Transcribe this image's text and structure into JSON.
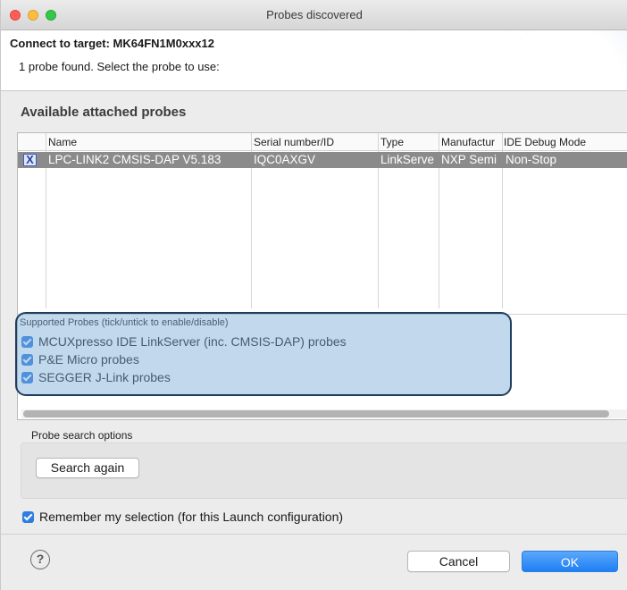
{
  "window": {
    "title": "Probes discovered"
  },
  "header": {
    "title": "Connect to target: MK64FN1M0xxx12",
    "message": "1 probe found. Select the probe to use:"
  },
  "probes_section": {
    "title": "Available attached probes",
    "columns": [
      "Name",
      "Serial number/ID",
      "Type",
      "Manufactur",
      "IDE Debug Mode"
    ],
    "rows": [
      {
        "selected": true,
        "checkbox_glyph": "X",
        "cells": [
          "LPC-LINK2 CMSIS-DAP V5.183",
          "IQC0AXGV",
          "LinkServe",
          "NXP Semi",
          "Non-Stop"
        ]
      }
    ]
  },
  "supported_probes": {
    "caption": "Supported Probes (tick/untick to enable/disable)",
    "items": [
      {
        "label": "MCUXpresso IDE LinkServer (inc. CMSIS-DAP) probes",
        "checked": true
      },
      {
        "label": "P&E Micro probes",
        "checked": true
      },
      {
        "label": "SEGGER J-Link probes",
        "checked": true
      }
    ]
  },
  "search_options": {
    "caption": "Probe search options",
    "search_again_label": "Search again"
  },
  "remember": {
    "label": "Remember my selection (for this Launch configuration)",
    "checked": true
  },
  "footer": {
    "help_glyph": "?",
    "cancel_label": "Cancel",
    "ok_label": "OK"
  },
  "colors": {
    "accent": "#2f7de1",
    "selected_row": "#8b8b8b",
    "highlight_fill": "#78aad7",
    "highlight_border": "#1f3d5c"
  }
}
